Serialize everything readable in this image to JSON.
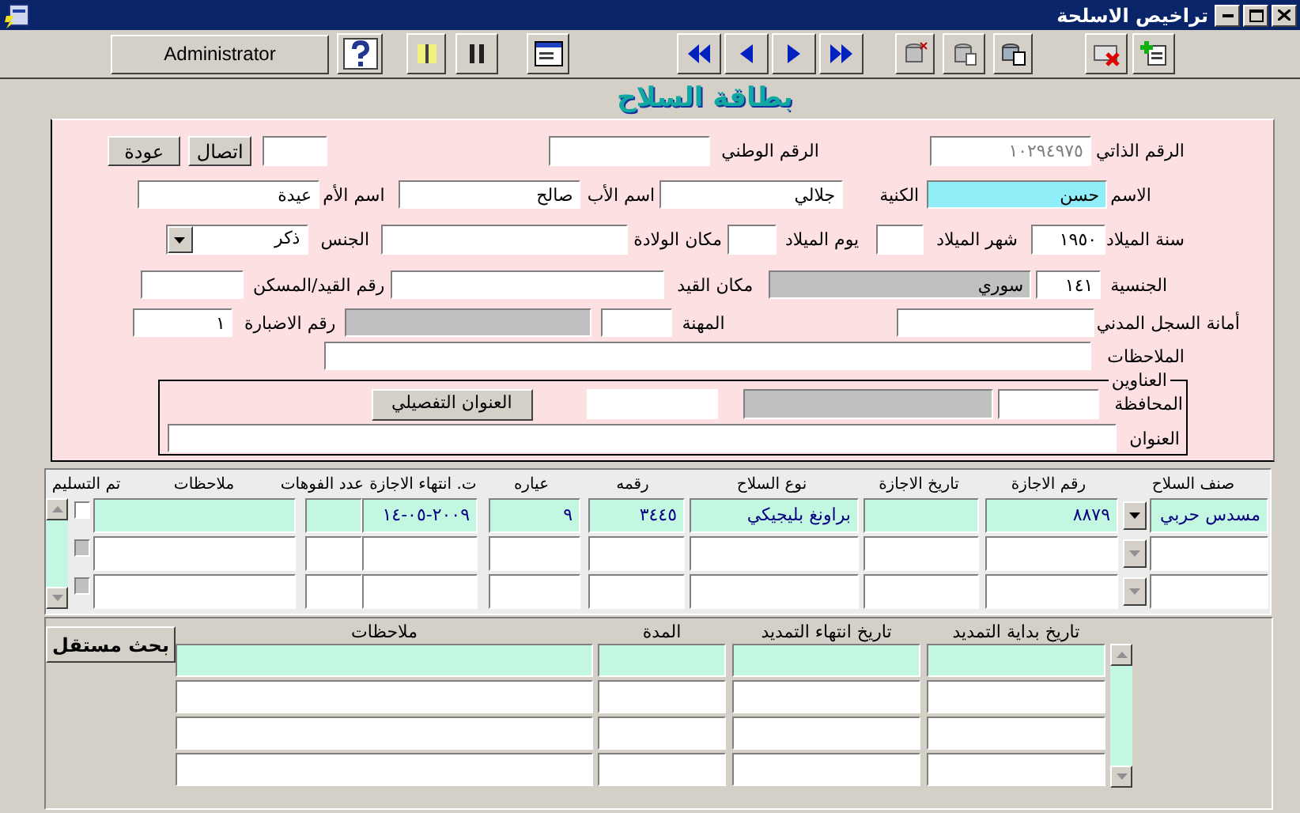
{
  "window": {
    "title": "تراخيص الاسلحة"
  },
  "toolbar": {
    "user": "Administrator"
  },
  "card": {
    "title": "بطاقة السلاح",
    "self_number": {
      "label": "الرقم الذاتي",
      "value": "١٠٢٩٤٩٧٥",
      "disabled": true
    },
    "national_number": {
      "label": "الرقم الوطني"
    },
    "buttons": [
      "اتصال",
      "عودة"
    ],
    "first_name": {
      "label": "الاسم",
      "value": "حسن",
      "focused": true
    },
    "family_name": {
      "label": "الكنية",
      "value": "جلالي"
    },
    "father_name": {
      "label": "اسم الأب",
      "value": "صالح"
    },
    "mother_name": {
      "label": "اسم الأم",
      "value": "عيدة"
    },
    "birth_year": {
      "label": "سنة الميلاد",
      "value": "١٩٥٠"
    },
    "birth_month": {
      "label": "شهر الميلاد"
    },
    "birth_day": {
      "label": "يوم الميلاد"
    },
    "birth_place": {
      "label": "مكان الولادة"
    },
    "sex": {
      "label": "الجنس",
      "value": "ذكر"
    },
    "nationality": {
      "label": "الجنسية",
      "code": "١٤١",
      "name": "سوري"
    },
    "registry_place": {
      "label": "مكان القيد"
    },
    "registry_number": {
      "label": "رقم القيد/المسكن"
    },
    "civil_registry": {
      "label": "أمانة السجل المدني"
    },
    "profession": {
      "label": "المهنة"
    },
    "file_number": {
      "label": "رقم الاضبارة",
      "value": "١"
    },
    "notes": {
      "label": "الملاحظات"
    },
    "addresses": {
      "legend": "العناوين",
      "governorate_label": "المحافظة",
      "detail_button": "العنوان التفصيلي",
      "address_label": "العنوان"
    }
  },
  "weapons": {
    "columns": [
      "صنف السلاح",
      "رقم الاجازة",
      "تاريخ الاجازة",
      "نوع السلاح",
      "رقمه",
      "عياره",
      "ت. انتهاء الاجازة",
      "عدد الفوهات",
      "ملاحظات",
      "تم التسليم"
    ],
    "rows": [
      {
        "class": "مسدس حربي",
        "license_no": "٨٨٧٩",
        "type": "براونغ بليجيكي",
        "number": "٣٤٤٥",
        "caliber": "٩",
        "license_expiry": "٢٠٠٩-٠٥-١٤",
        "selected": true,
        "delivered": false
      },
      {
        "selected": false,
        "delivered": false
      },
      {
        "selected": false,
        "delivered": false
      }
    ]
  },
  "extensions": {
    "search_button": "بحث مستقل",
    "columns": [
      "تاريخ بداية التمديد",
      "تاريخ انتهاء التمديد",
      "المدة",
      "ملاحظات"
    ],
    "rows": [
      {
        "selected": true
      },
      {
        "selected": false
      },
      {
        "selected": false
      },
      {
        "selected": false
      }
    ]
  }
}
